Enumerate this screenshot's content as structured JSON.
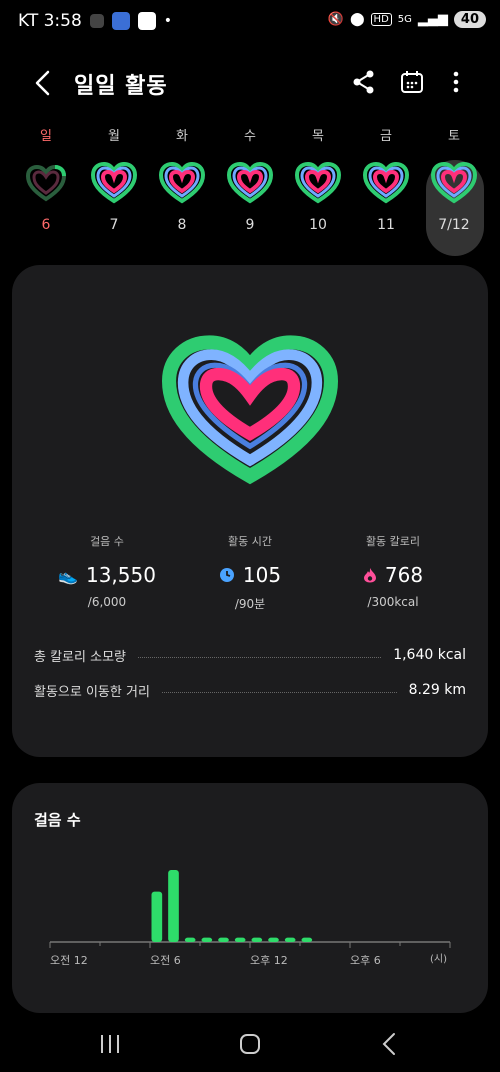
{
  "status_bar": {
    "time": "KT 3:58",
    "battery": "40",
    "network": "5G"
  },
  "header": {
    "title": "일일 활동"
  },
  "week": {
    "days": [
      {
        "label": "일",
        "date": "6"
      },
      {
        "label": "월",
        "date": "7"
      },
      {
        "label": "화",
        "date": "8"
      },
      {
        "label": "수",
        "date": "9"
      },
      {
        "label": "목",
        "date": "10"
      },
      {
        "label": "금",
        "date": "11"
      },
      {
        "label": "토",
        "date": "7/12"
      }
    ]
  },
  "summary": {
    "steps": {
      "label": "걸음 수",
      "value": "13,550",
      "goal": "/6,000"
    },
    "active_time": {
      "label": "활동 시간",
      "value": "105",
      "goal": "/90분"
    },
    "active_calories": {
      "label": "활동 칼로리",
      "value": "768",
      "goal": "/300kcal"
    },
    "total_calories": {
      "label": "총 칼로리 소모량",
      "value": "1,640 kcal"
    },
    "distance": {
      "label": "활동으로 이동한 거리",
      "value": "8.29 km"
    }
  },
  "steps_card": {
    "title": "걸음 수",
    "axis_labels": [
      "오전 12",
      "오전 6",
      "오후 12",
      "오후 6"
    ],
    "unit": "(시)"
  },
  "colors": {
    "ring_outer": "#2ecc71",
    "ring_middle": "#5fa8ff",
    "ring_inner": "#ff2f7a",
    "steps_bar": "#2edc6a",
    "time_icon": "#4aa3ff",
    "calorie_icon": "#ff4f9a"
  },
  "chart_data": {
    "type": "bar",
    "x": [
      "오전 12",
      "오전 6",
      "오후 12",
      "오후 6"
    ],
    "hours": [
      6,
      7,
      8,
      9,
      10,
      11,
      12,
      13,
      14,
      15
    ],
    "values": [
      0.7,
      1.0,
      0.06,
      0.06,
      0.06,
      0.06,
      0.06,
      0.06,
      0.06,
      0.06
    ],
    "ylabel": "",
    "xlabel": "(시)"
  }
}
